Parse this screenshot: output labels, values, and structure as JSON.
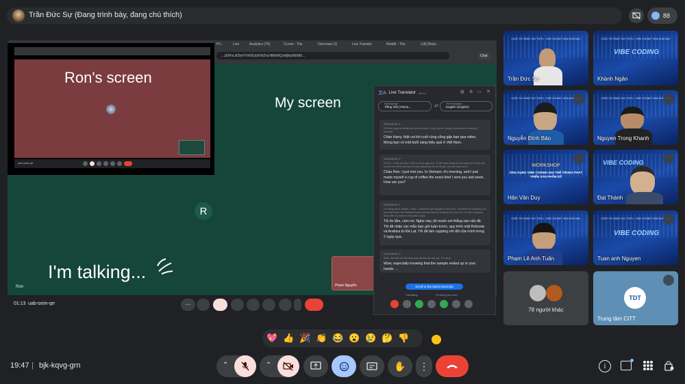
{
  "presenter": {
    "title": "Trần Đức Sự (Đang trình bày, đang chú thích)"
  },
  "top": {
    "participant_count": "88"
  },
  "browser_tabs": [
    "PV...",
    "Live",
    "Analytics (79)",
    "Ct.min - The",
    "Overview (1)",
    "Live Translat",
    "Reddit - The",
    "(18) [Repl..."
  ],
  "browser_url": "…JEIPvLAZbhYVhN5JdXWZhcHBfdWQzMjMyMDM5...",
  "browser_chat": "Chat",
  "inner_share": {
    "label": "Ron's screen",
    "meet_code": "uab-sxim-qrr"
  },
  "main_share": {
    "label": "My screen",
    "talking": "I'm talking...",
    "avatar_letter": "R",
    "self_name": "Ron",
    "tile_name": "Phạm Nguyễn",
    "time": "01:13",
    "code": "uab-sxim-qrr"
  },
  "live_translator": {
    "title": "Live Translator",
    "version": "v0.9.2",
    "my_language_label": "My language",
    "my_language": "Tiếng Việt (Vietna...",
    "their_language_label": "Their language",
    "their_language": "English (English)",
    "cards": [
      {
        "speaker": "SPEAKER 1",
        "original": "Hi Harry, good to finally see you on video. I hope you're having a productive morning in Vietnam.",
        "translation": "Chào Harry, thật vui khi cuối cùng cũng gặp bạn qua video. Mong bạn có một buổi sáng hiệu quả ở Việt Nam."
      },
      {
        "speaker": "SPEAKER 2",
        "original": "Hi Ron - Chào anh Ron. Rất vui được gặp anh. Ở Việt Nam đang là buổi sáng và tôi vừa mới tự pha cho mình một tách cà phê giống loại mà tôi đã gửi cho anh tuần trước.",
        "translation": "Chào Ron. I just met you. In Vietnam, it's morning, and I just made myself a cup of coffee the exact kind I sent you last week. How are you?"
      },
      {
        "speaker": "SPEAKER 1",
        "original": "I'm doing great, thanks. Listen, I wanted to get straight to the point. I received the samples you sent last week, the Robusta honey process and the Arabica from Da Lat. I've been cupping them with my team for the past 2 days.",
        "translation": "Tôi ổn lắm, cảm ơn. Nghe này, tôi muốn nói thẳng vào vấn đề. Tôi đã nhận các mẫu bạn gửi tuần trước, quy trình mật Robusta và Arabica từ Đà Lạt. Tôi đã làm cupping với đội của mình trong 2 ngày qua."
      },
      {
        "speaker": "SPEAKER 2",
        "original": "Wow, đặc biệt khi biết rằng mẫu đã đến tận tay anh. Tôi rất là",
        "translation": "Wow, especially knowing that the sample ended up in your hands. ..."
      }
    ],
    "scroll_button": "Scroll to the latest transcript",
    "status_left": "Translating...",
    "status_right": "I'm hiding your voice"
  },
  "participants": [
    {
      "name": "Trần Đức Sự"
    },
    {
      "name": "Khánh Ngân"
    },
    {
      "name": "Nguyễn Đình Bảo"
    },
    {
      "name": "Nguyen Trong Khanh"
    },
    {
      "name": "Hân Văn Duy"
    },
    {
      "name": "Đạt Thành"
    },
    {
      "name": "Phạm Lê Anh Tuấn"
    },
    {
      "name": "Tuan anh Nguyen"
    }
  ],
  "others": {
    "label": "78 người khác"
  },
  "citt": {
    "name": "Trung tâm CITT",
    "logo": "TDT"
  },
  "banner_text": {
    "contest": "CUỘC THI SÁNG TẠO \"DSTU - VIBE CODING\" MÙA KHAI MẠC",
    "brand": "VIBE CODING",
    "workshop": "WORKSHOP",
    "workshop_sub": "ỨNG DỤNG VIBE CODING MẠI THỂ TRONG PHÁT TRIỂN SẢN PHẨM SỐ"
  },
  "reactions": [
    "💖",
    "👍",
    "🎉",
    "👏",
    "😂",
    "😮",
    "😢",
    "🤔",
    "👎"
  ],
  "bottom": {
    "time": "19:47",
    "separator": "|",
    "meeting_code": "bjk-kqvg-grn"
  },
  "colors": {
    "bg": "#202124",
    "danger": "#ea4335",
    "mic_off_bg": "#f9dedc",
    "emoji_active": "#a8c7fa",
    "stage_green": "#154639"
  }
}
